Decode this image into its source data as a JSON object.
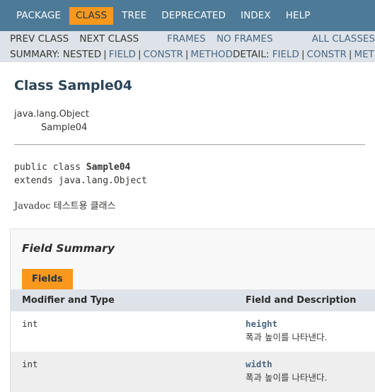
{
  "topnav": {
    "items": [
      {
        "label": "PACKAGE",
        "active": false
      },
      {
        "label": "CLASS",
        "active": true
      },
      {
        "label": "TREE",
        "active": false
      },
      {
        "label": "DEPRECATED",
        "active": false
      },
      {
        "label": "INDEX",
        "active": false
      },
      {
        "label": "HELP",
        "active": false
      }
    ],
    "bg_color": "#4d7a97",
    "active_color": "#f8981d"
  },
  "subnav": {
    "prev_class": "PREV CLASS",
    "next_class": "NEXT CLASS",
    "frames": "FRAMES",
    "no_frames": "NO FRAMES",
    "all_classes": "ALL CLASSES",
    "summary_label": "SUMMARY:",
    "summary_nested": "NESTED",
    "summary_field": "FIELD",
    "summary_constr": "CONSTR",
    "summary_method": "METHOD",
    "detail_label": "DETAIL:",
    "detail_field": "FIELD",
    "detail_constr": "CONSTR",
    "detail_method": "METHOD",
    "separator": "|",
    "bg_color": "#dee3e9",
    "link_color": "#4a6782"
  },
  "main": {
    "page_title": "Class Sample04",
    "inheritance": {
      "level1": "java.lang.Object",
      "level2": "Sample04"
    },
    "declaration": {
      "line1_prefix": "public class ",
      "line1_name": "Sample04",
      "line2": "extends java.lang.Object"
    },
    "class_description": "Javadoc 테스트용 클래스"
  },
  "field_summary": {
    "heading": "Field Summary",
    "tab_label": "Fields",
    "columns": [
      "Modifier and Type",
      "Field and Description"
    ],
    "rows": [
      {
        "modifier_and_type": "int",
        "field_name": "height",
        "field_description": "폭과 높이를 나타낸다."
      },
      {
        "modifier_and_type": "int",
        "field_name": "width",
        "field_description": "폭과 높이를 나타낸다."
      }
    ]
  }
}
